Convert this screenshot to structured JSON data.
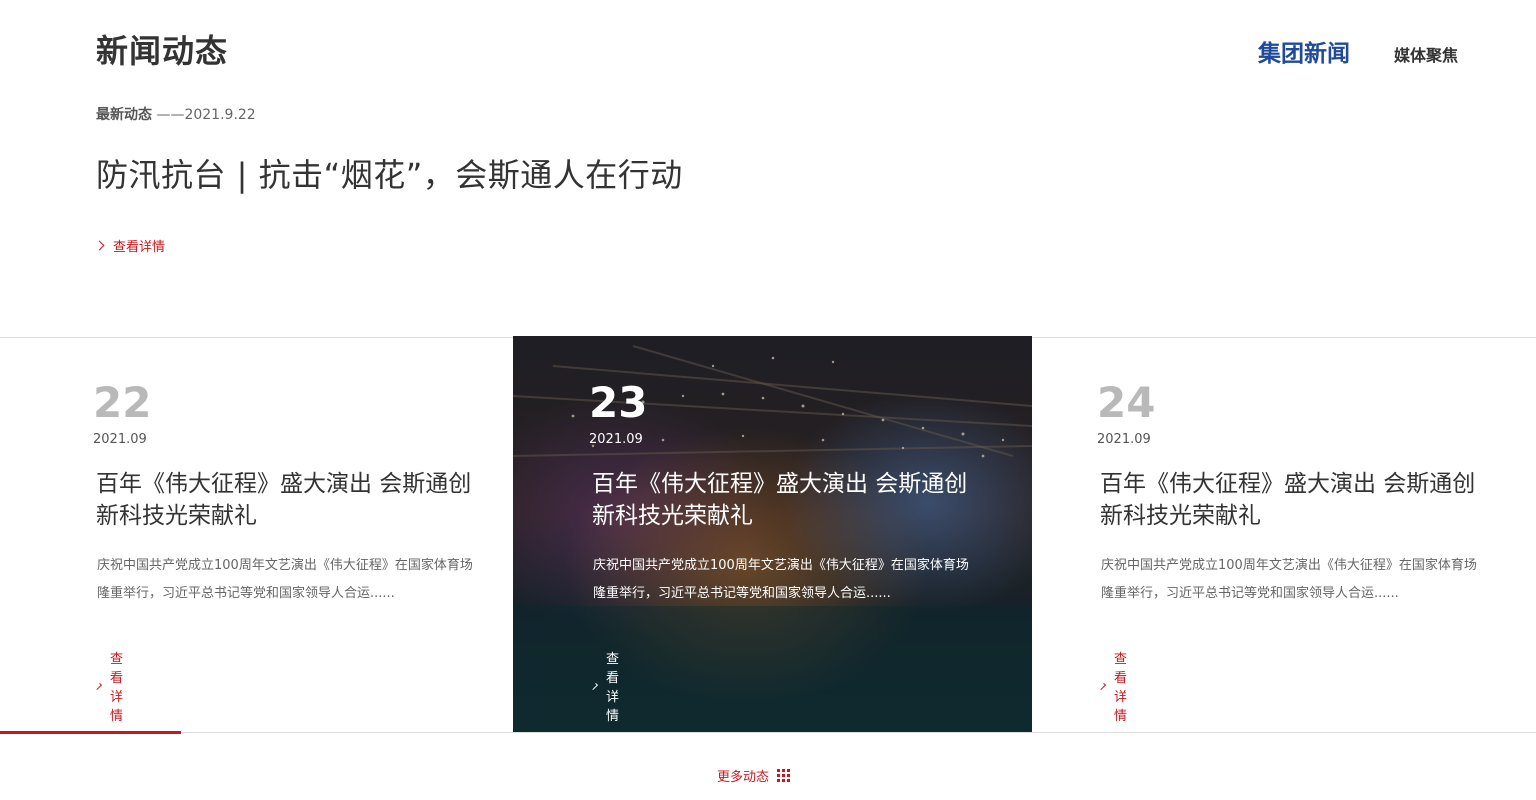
{
  "header": {
    "section_title": "新闻动态",
    "tabs": [
      {
        "label": "集团新闻",
        "active": true
      },
      {
        "label": "媒体聚焦",
        "active": false
      }
    ]
  },
  "featured": {
    "latest_label": "最新动态",
    "date": "——2021.9.22",
    "title": "防汛抗台 | 抗击“烟花”，会斯通人在行动",
    "more_label": "查看详情"
  },
  "cards": [
    {
      "day": "22",
      "year_month": "2021.09",
      "title": "百年《伟大征程》盛大演出 会斯通创新科技光荣献礼",
      "desc": "庆祝中国共产党成立100周年文艺演出《伟大征程》在国家体育场隆重举行，习近平总书记等党和国家领导人合运......",
      "more_label": "查看详情",
      "active": false
    },
    {
      "day": "23",
      "year_month": "2021.09",
      "title": "百年《伟大征程》盛大演出 会斯通创新科技光荣献礼",
      "desc": "庆祝中国共产党成立100周年文艺演出《伟大征程》在国家体育场隆重举行，习近平总书记等党和国家领导人合运......",
      "more_label": "查看详情",
      "active": true
    },
    {
      "day": "24",
      "year_month": "2021.09",
      "title": "百年《伟大征程》盛大演出 会斯通创新科技光荣献礼",
      "desc": "庆祝中国共产党成立100周年文艺演出《伟大征程》在国家体育场隆重举行，习近平总书记等党和国家领导人合运......",
      "more_label": "查看详情",
      "active": false
    }
  ],
  "footer": {
    "more_label": "更多动态"
  },
  "colors": {
    "accent": "#c8171e",
    "tab_active": "#1f4a9c",
    "text": "#333333"
  }
}
